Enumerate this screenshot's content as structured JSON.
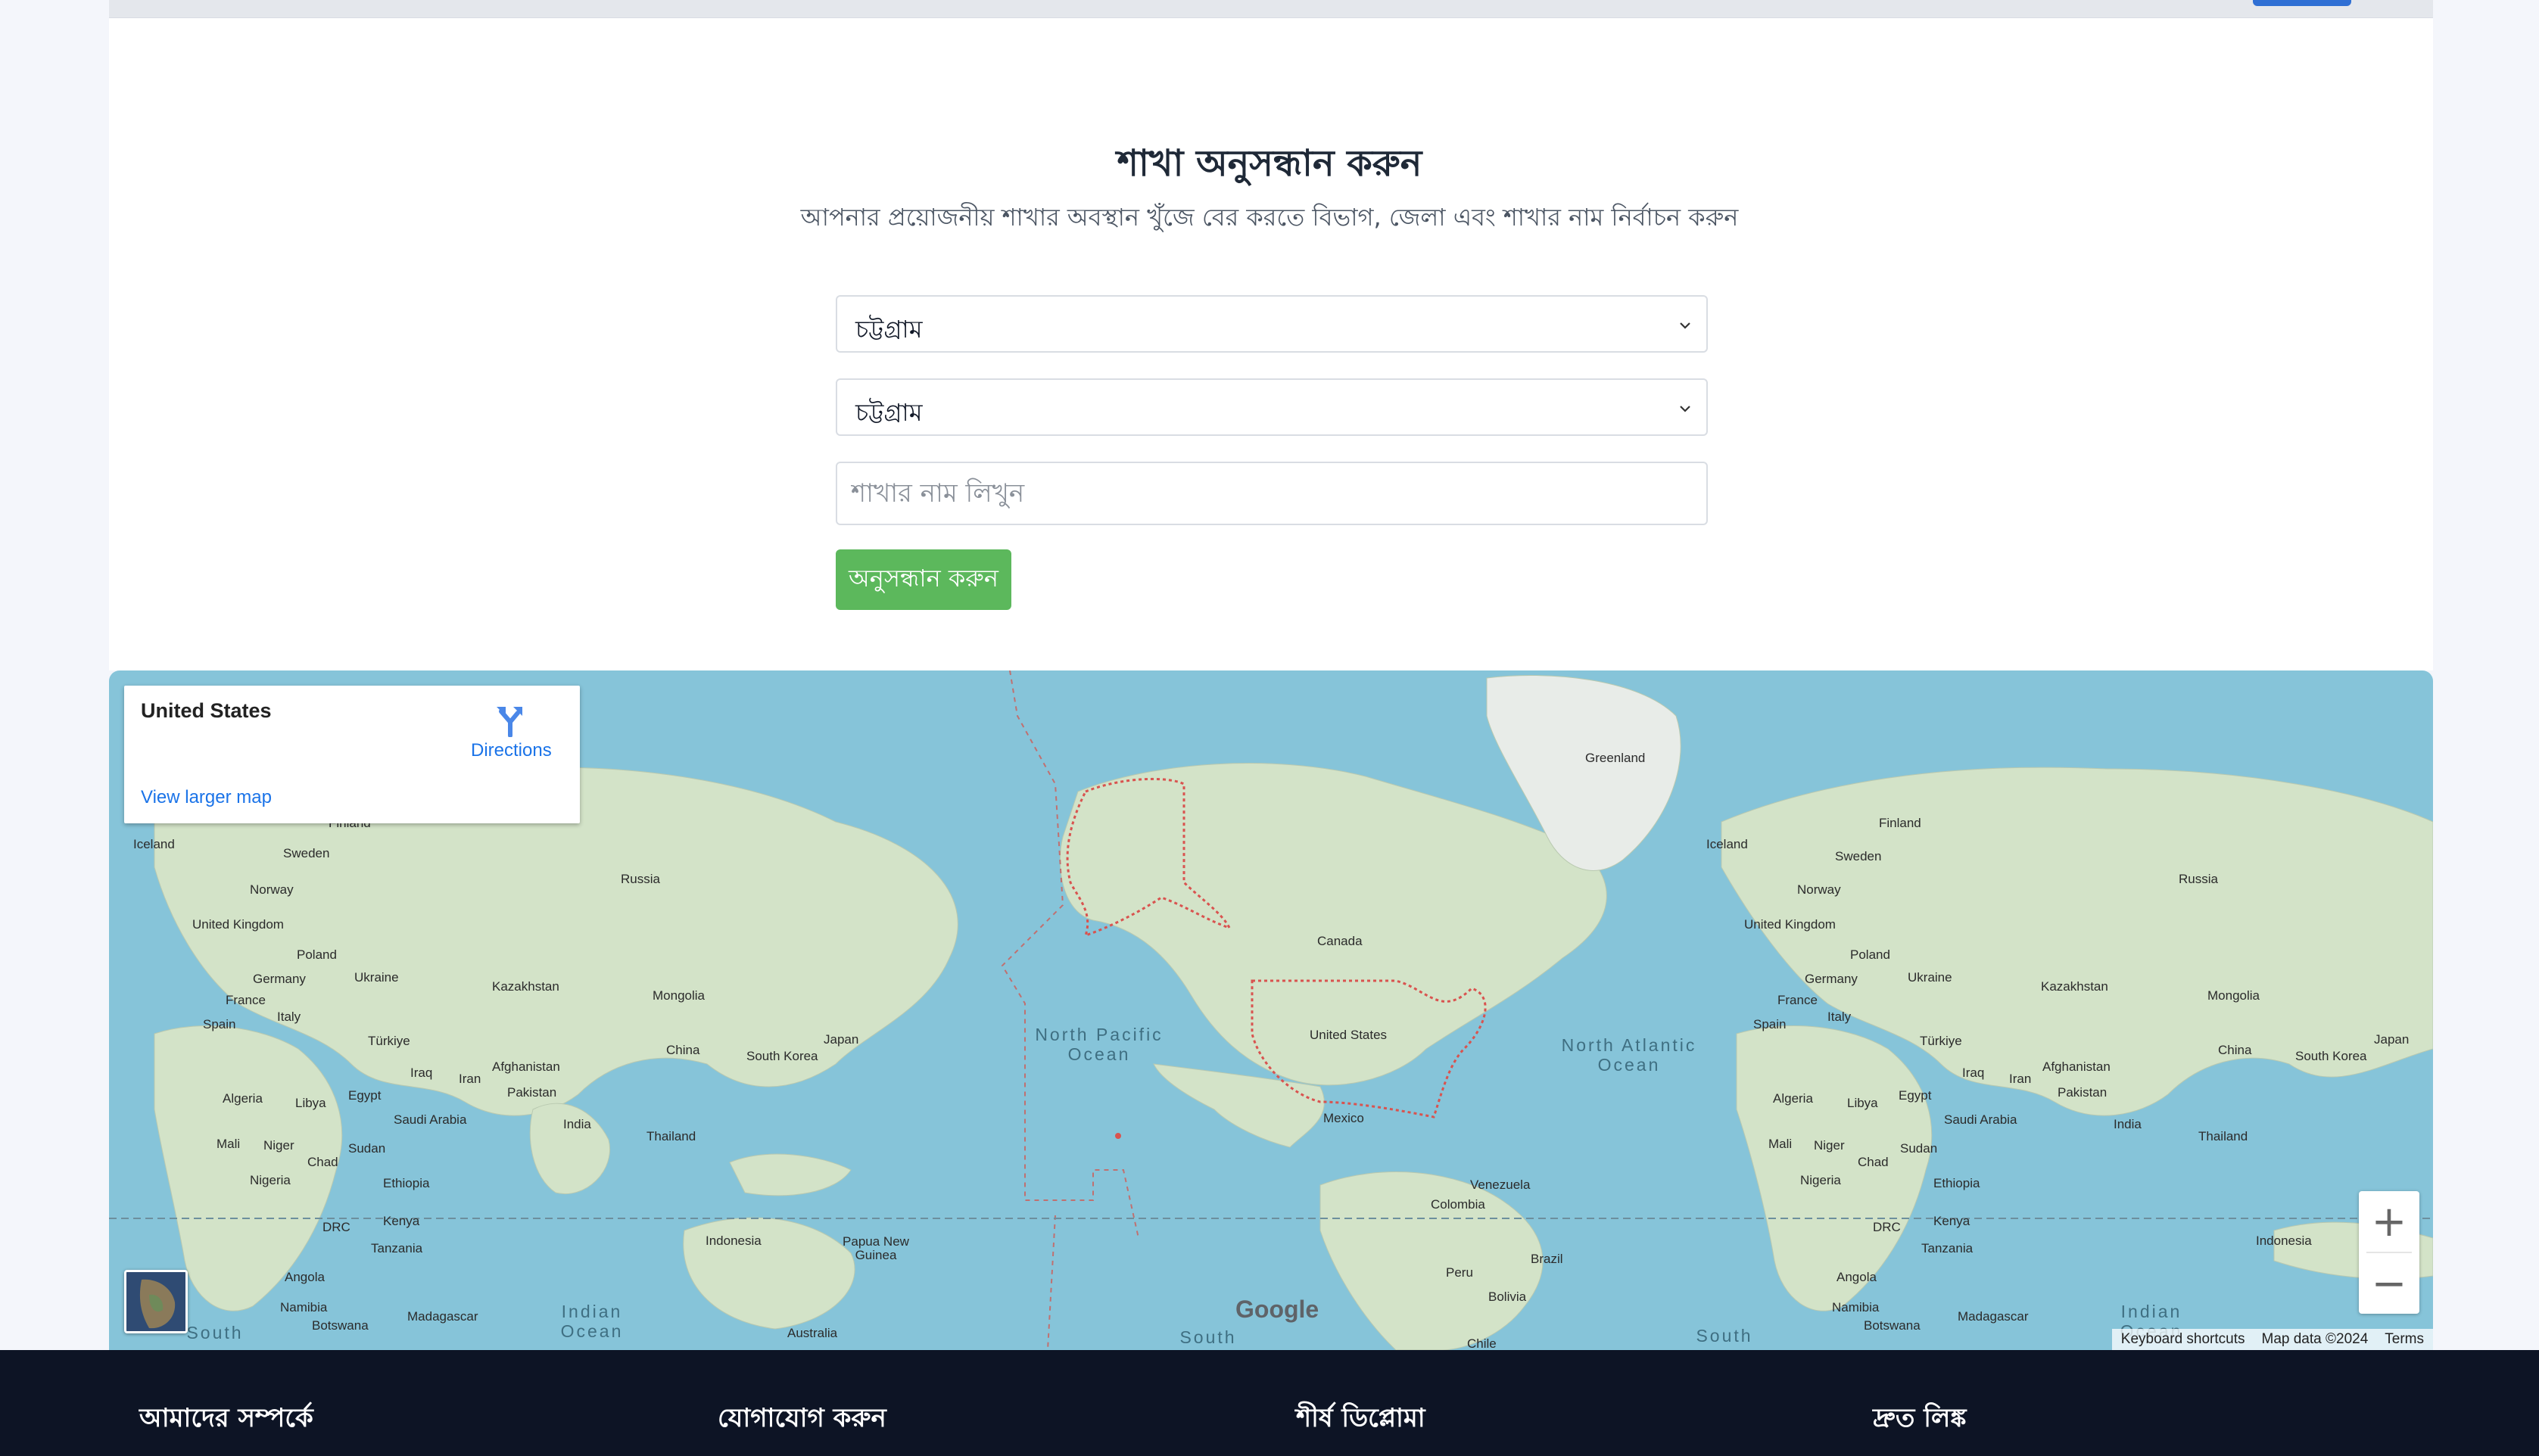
{
  "header": {
    "title": "শাখা অনুসন্ধান করুন",
    "subtitle": "আপনার প্রয়োজনীয় শাখার অবস্থান খুঁজে বের করতে বিভাগ, জেলা এবং শাখার নাম নির্বাচন করুন"
  },
  "form": {
    "division_value": "চট্টগ্রাম",
    "district_value": "চট্টগ্রাম",
    "branch_placeholder": "শাখার নাম লিখুন",
    "search_label": "অনুসন্ধান করুন"
  },
  "map": {
    "place_title": "United States",
    "directions_label": "Directions",
    "larger_map_label": "View larger map",
    "zoom_in": "+",
    "zoom_out": "−",
    "attribution": {
      "shortcuts": "Keyboard shortcuts",
      "map_data": "Map data ©2024",
      "terms": "Terms"
    },
    "logo": "Google",
    "labels": [
      "Iceland",
      "Finland",
      "Sweden",
      "Norway",
      "Russia",
      "United Kingdom",
      "Poland",
      "Germany",
      "Ukraine",
      "France",
      "Italy",
      "Spain",
      "Kazakhstan",
      "Mongolia",
      "Türkiye",
      "China",
      "Japan",
      "South Korea",
      "Afghanistan",
      "Iraq",
      "Iran",
      "Pakistan",
      "Algeria",
      "Libya",
      "Egypt",
      "Saudi Arabia",
      "India",
      "Thailand",
      "Mali",
      "Niger",
      "Chad",
      "Sudan",
      "Nigeria",
      "Ethiopia",
      "DRC",
      "Kenya",
      "Tanzania",
      "Angola",
      "Namibia",
      "Botswana",
      "Madagascar",
      "Indonesia",
      "Papua New Guinea",
      "Australia",
      "Greenland",
      "Canada",
      "United States",
      "Mexico",
      "Venezuela",
      "Colombia",
      "Peru",
      "Brazil",
      "Bolivia",
      "Chile",
      "Iceland",
      "Sweden",
      "Norway",
      "Finland",
      "Russia",
      "United Kingdom",
      "Poland",
      "Germany",
      "Ukraine",
      "France",
      "Italy",
      "Spain",
      "Kazakhstan",
      "Mongolia",
      "Türkiye",
      "China",
      "Japan",
      "South Korea",
      "Afghanistan",
      "Iraq",
      "Iran",
      "Pakistan",
      "Algeria",
      "Libya",
      "Egypt",
      "Saudi Arabia",
      "India",
      "Thailand",
      "Mali",
      "Niger",
      "Chad",
      "Sudan",
      "Nigeria",
      "Ethiopia",
      "DRC",
      "Kenya",
      "Tanzania",
      "Angola",
      "Namibia",
      "Botswana",
      "Madagascar",
      "Indonesia"
    ],
    "oceans": [
      "North Pacific Ocean",
      "North Atlantic Ocean",
      "Indian Ocean",
      "Indian Ocean",
      "South",
      "South",
      "South"
    ]
  },
  "footer": {
    "col1": "আমাদের সম্পর্কে",
    "col2": "যোগাযোগ করুন",
    "col3": "শীর্ষ ডিপ্লোমা",
    "col4": "দ্রুত লিঙ্ক"
  },
  "colors": {
    "primary_button": "#5cb85c",
    "footer_bg": "#0d1425",
    "map_water": "#86c4d9",
    "land": "#d8e6d0",
    "boundary_highlight": "#d9534f"
  }
}
